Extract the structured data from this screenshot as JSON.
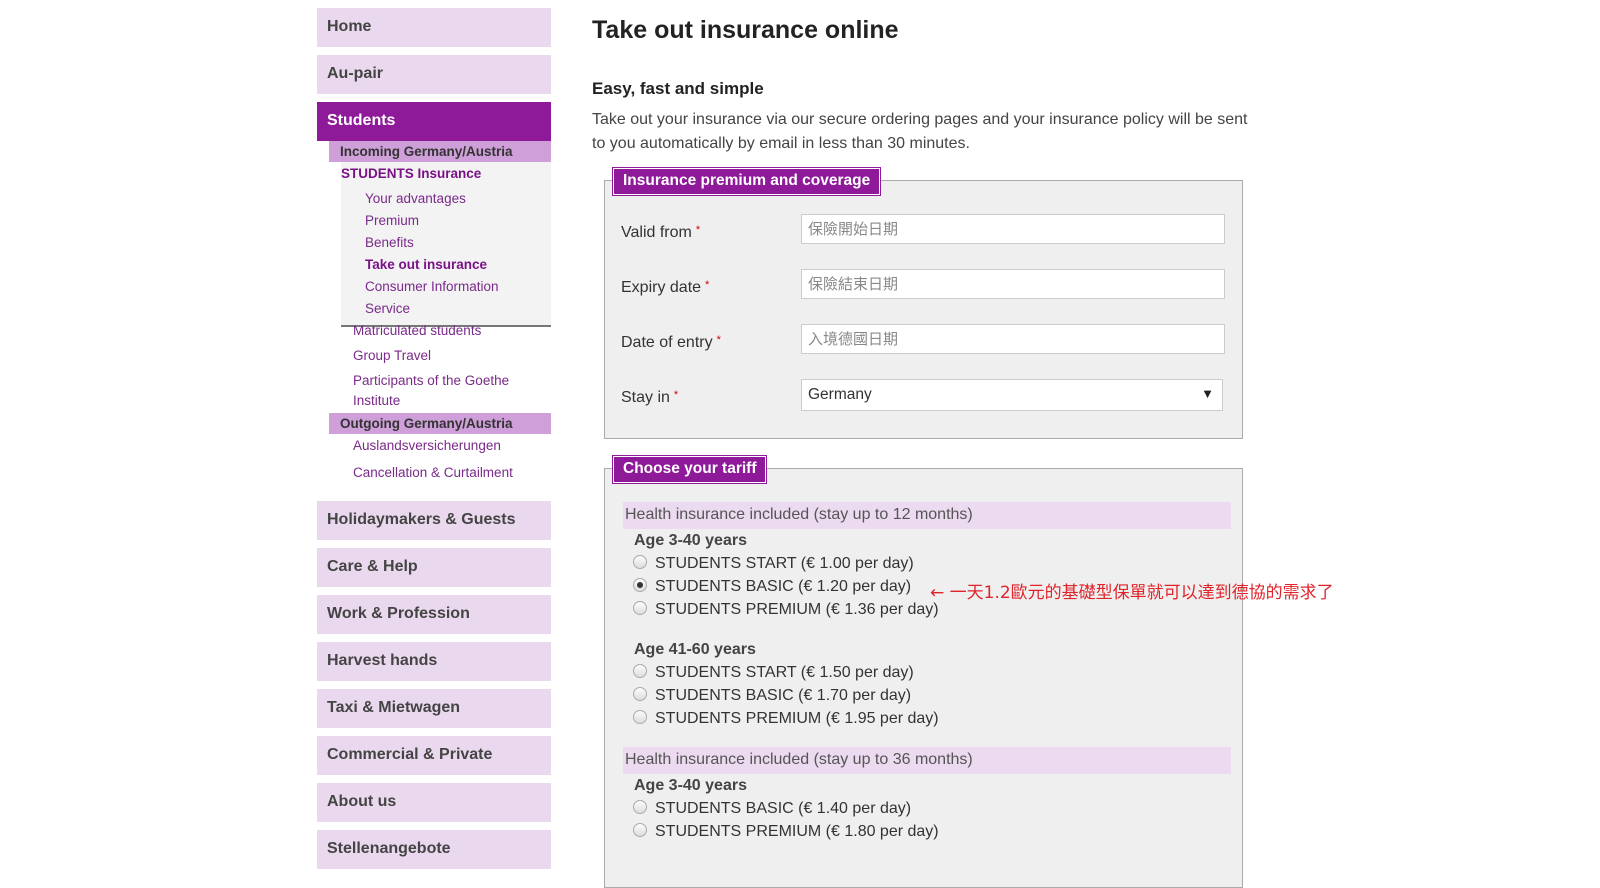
{
  "sidebar": {
    "top_items": [
      "Home",
      "Au-pair"
    ],
    "active_item": "Students",
    "incoming": {
      "header": "Incoming Germany/Austria",
      "title": "STUDENTS Insurance",
      "links": [
        "Your advantages",
        "Premium",
        "Benefits",
        "Take out insurance",
        "Consumer Information",
        "Service"
      ],
      "current": "Take out insurance",
      "more_links": [
        "Matriculated students",
        "Group Travel",
        "Participants of the Goethe Institute"
      ]
    },
    "outgoing": {
      "header": "Outgoing Germany/Austria",
      "links": [
        "Auslandsversicherungen",
        "Cancellation & Curtailment"
      ]
    },
    "bottom_items": [
      "Holidaymakers & Guests",
      "Care & Help",
      "Work & Profession",
      "Harvest hands",
      "Taxi & Mietwagen",
      "Commercial & Private",
      "About us",
      "Stellenangebote"
    ]
  },
  "main": {
    "title": "Take out insurance online",
    "subtitle": "Easy, fast and simple",
    "intro": "Take out your insurance via our secure ordering pages and your insurance policy will be sent to you automatically by email in less than 30 minutes.",
    "coverage": {
      "legend": "Insurance premium and coverage",
      "required_mark": "*",
      "valid_from": {
        "label": "Valid from",
        "placeholder": "保險開始日期"
      },
      "expiry_date": {
        "label": "Expiry date",
        "placeholder": "保險結束日期"
      },
      "date_of_entry": {
        "label": "Date of entry",
        "placeholder": "入境德國日期"
      },
      "stay_in": {
        "label": "Stay in",
        "value": "Germany",
        "arrow": "▼"
      }
    },
    "tariff": {
      "legend": "Choose your tariff",
      "groups": [
        {
          "header": "Health insurance included (stay up to 12 months)",
          "ages": [
            {
              "title": "Age 3-40 years",
              "options": [
                "STUDENTS START (€ 1.00 per day)",
                "STUDENTS BASIC (€ 1.20 per day)",
                "STUDENTS PREMIUM (€ 1.36 per day)"
              ]
            },
            {
              "title": "Age 41-60 years",
              "options": [
                "STUDENTS START (€ 1.50 per day)",
                "STUDENTS BASIC (€ 1.70 per day)",
                "STUDENTS PREMIUM (€ 1.95 per day)"
              ]
            }
          ]
        },
        {
          "header": "Health insurance included (stay up to 36 months)",
          "ages": [
            {
              "title": "Age 3-40 years",
              "options": [
                "STUDENTS BASIC (€ 1.40 per day)",
                "STUDENTS PREMIUM (€ 1.80 per day)"
              ]
            }
          ]
        }
      ],
      "selected": "STUDENTS BASIC (€ 1.20 per day)"
    },
    "annotation": "← 一天1.2歐元的基礎型保單就可以達到德協的需求了"
  }
}
